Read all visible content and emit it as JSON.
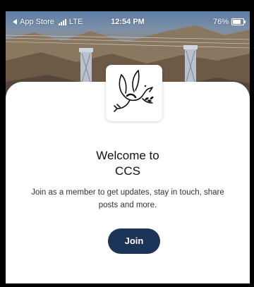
{
  "status_bar": {
    "back_app": "App Store",
    "carrier": "LTE",
    "time": "12:54 PM",
    "battery_percent": "76%",
    "battery_level": 0.76,
    "signal_bars": 4
  },
  "logo": {
    "icon": "dove-with-olive-branch"
  },
  "welcome": {
    "title_line1": "Welcome to",
    "title_line2": "CCS",
    "subtitle": "Join as a member to get updates, stay in touch, share posts and more."
  },
  "actions": {
    "join_label": "Join"
  },
  "colors": {
    "button": "#1c3457",
    "card": "#ffffff",
    "background": "#000000"
  }
}
